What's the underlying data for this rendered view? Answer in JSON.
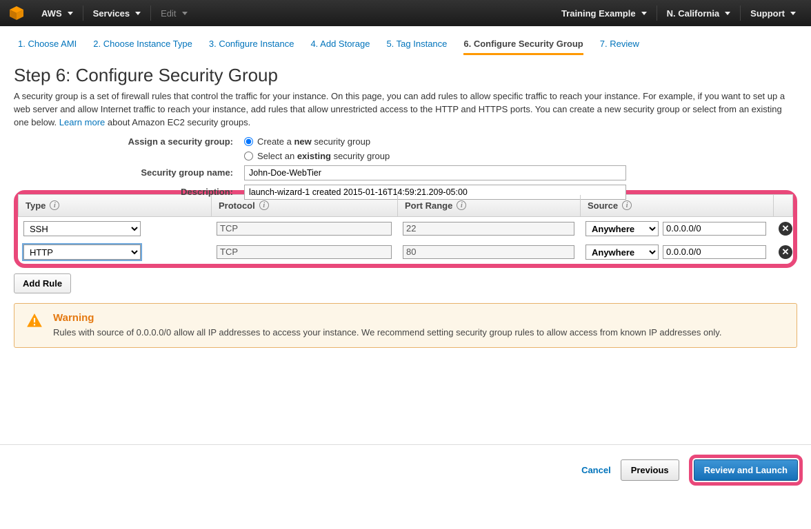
{
  "topnav": {
    "brand": "AWS",
    "services": "Services",
    "edit": "Edit",
    "account": "Training Example",
    "region": "N. California",
    "support": "Support"
  },
  "tabs": [
    "1. Choose AMI",
    "2. Choose Instance Type",
    "3. Configure Instance",
    "4. Add Storage",
    "5. Tag Instance",
    "6. Configure Security Group",
    "7. Review"
  ],
  "activeTabIndex": 5,
  "heading": "Step 6: Configure Security Group",
  "descPart1": "A security group is a set of firewall rules that control the traffic for your instance. On this page, you can add rules to allow specific traffic to reach your instance. For example, if you want to set up a web server and allow Internet traffic to reach your instance, add rules that allow unrestricted access to the HTTP and HTTPS ports. You can create a new security group or select from an existing one below. ",
  "learnMore": "Learn more",
  "descPart2": " about Amazon EC2 security groups.",
  "assignLabel": "Assign a security group:",
  "assignOpt1a": "Create a ",
  "assignOpt1b": "new",
  "assignOpt1c": " security group",
  "assignOpt2a": "Select an ",
  "assignOpt2b": "existing",
  "assignOpt2c": " security group",
  "sgNameLabel": "Security group name:",
  "sgNameValue": "John-Doe-WebTier",
  "sgDescLabel": "Description:",
  "sgDescValue": "launch-wizard-1 created 2015-01-16T14:59:21.209-05:00",
  "cols": {
    "type": "Type",
    "protocol": "Protocol",
    "port": "Port Range",
    "source": "Source"
  },
  "rules": [
    {
      "type": "SSH",
      "protocol": "TCP",
      "port": "22",
      "source": "Anywhere",
      "cidr": "0.0.0.0/0",
      "focused": false
    },
    {
      "type": "HTTP",
      "protocol": "TCP",
      "port": "80",
      "source": "Anywhere",
      "cidr": "0.0.0.0/0",
      "focused": true
    }
  ],
  "addRule": "Add Rule",
  "warning": {
    "title": "Warning",
    "body": "Rules with source of 0.0.0.0/0 allow all IP addresses to access your instance. We recommend setting security group rules to allow access from known IP addresses only."
  },
  "footer": {
    "cancel": "Cancel",
    "previous": "Previous",
    "review": "Review and Launch"
  }
}
